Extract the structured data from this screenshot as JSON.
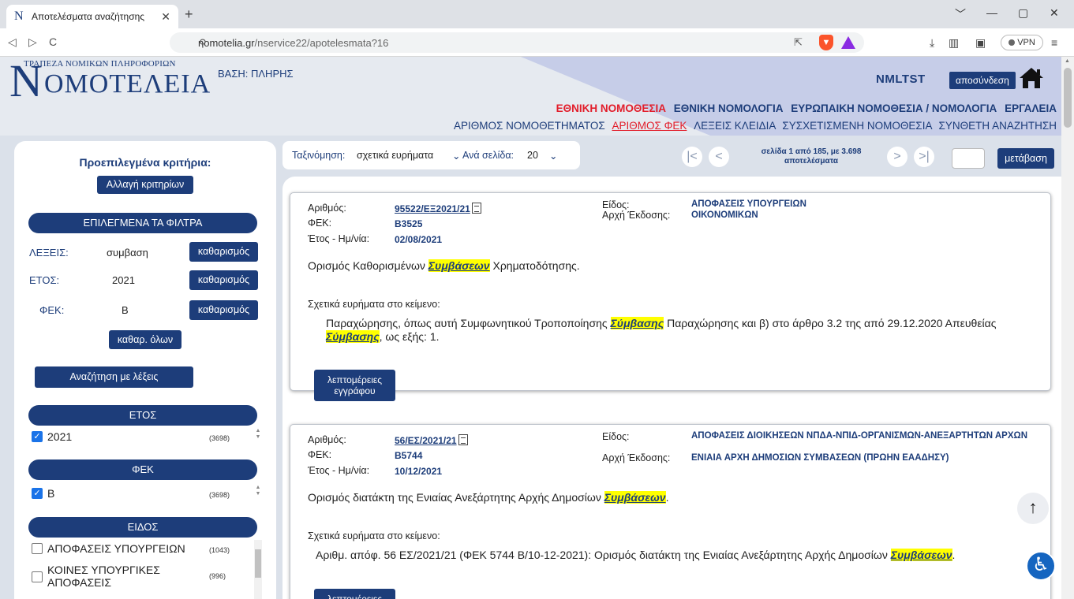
{
  "browser": {
    "tab_title": "Αποτελέσματα αναζήτησης",
    "tab_favicon": "N",
    "url_host": "nomotelia.gr",
    "url_path": "/nservice22/apotelesmata?16",
    "vpn_label": "VPN"
  },
  "header": {
    "logo_top": "ΤΡΑΠΕΖΑ ΝΟΜΙΚΩΝ ΠΛΗΡΟΦΟΡΙΩΝ",
    "logo_initial": "Ν",
    "logo_rest": "ΟΜΟΤΕΛΕΙΑ",
    "basis": "ΒΑΣΗ: ΠΛΗΡΗΣ",
    "username": "NMLTST",
    "logout_label": "αποσύνδεση",
    "nav_main": [
      "ΕΘΝΙΚΗ ΝΟΜΟΘΕΣΙΑ",
      "ΕΘΝΙΚΗ ΝΟΜΟΛΟΓΙΑ",
      "ΕΥΡΩΠΑΙΚΗ ΝΟΜΟΘΕΣΙΑ / ΝΟΜΟΛΟΓΙΑ",
      "ΕΡΓΑΛΕΙΑ"
    ],
    "nav_sub": [
      "ΑΡΙΘΜΟΣ ΝΟΜΟΘΕΤΗΜΑΤΟΣ",
      "ΑΡΙΘΜΟΣ ΦΕΚ",
      "ΛΕΞΕΙΣ ΚΛΕΙΔΙΑ",
      "ΣΥΣΧΕΤΙΣΜΕΝΗ ΝΟΜΟΘΕΣΙΑ",
      "ΣΥΝΘΕΤΗ ΑΝΑΖΗΤΗΣΗ"
    ],
    "active_color": "#e21d2a",
    "brand_color": "#1d3d7a"
  },
  "sidebar": {
    "title": "Προεπιλεγμένα κριτήρια:",
    "change_criteria": "Αλλαγή κριτηρίων",
    "selected_filters_header": "ΕΠΙΛΕΓΜΕΝΑ ΤΑ ΦΙΛΤΡΑ",
    "filters": [
      {
        "label": "ΛΕΞΕΙΣ:",
        "value": "συμβαση",
        "clear": "καθαρισμός"
      },
      {
        "label": "ΕΤΟΣ:",
        "value": "2021",
        "clear": "καθαρισμός"
      },
      {
        "label": "ΦΕΚ:",
        "value": "Β",
        "clear": "καθαρισμός"
      }
    ],
    "clear_all": "καθαρ. όλων",
    "search_words": "Αναζήτηση με λέξεις",
    "year_header": "ΕΤΟΣ",
    "year_items": [
      {
        "label": "2021",
        "count": "(3698)",
        "checked": true
      }
    ],
    "fek_header": "ΦΕΚ",
    "fek_items": [
      {
        "label": "Β",
        "count": "(3698)",
        "checked": true
      }
    ],
    "type_header": "ΕΙΔΟΣ",
    "type_items": [
      {
        "label": "ΑΠΟΦΑΣΕΙΣ ΥΠΟΥΡΓΕΙΩΝ",
        "count": "(1043)",
        "checked": false
      },
      {
        "label": "ΚΟΙΝΕΣ ΥΠΟΥΡΓΙΚΕΣ ΑΠΟΦΑΣΕΙΣ",
        "count": "(996)",
        "checked": false
      }
    ]
  },
  "toolbar": {
    "sort_label": "Ταξινόμηση:",
    "sort_value": "σχετικά ευρήματα",
    "per_page_label": "Ανά σελίδα:",
    "per_page_value": "20",
    "page_info_line1": "σελίδα 1 από 185, με 3.698",
    "page_info_line2": "αποτελέσματα",
    "goto_label": "μετάβαση",
    "page_input_value": ""
  },
  "results": [
    {
      "k_number": "Αριθμός:",
      "number": "95522/ΕΞ2021/21",
      "k_fek": "ΦΕΚ:",
      "fek": "Β3525",
      "k_date": "Έτος - Ημ/νία:",
      "date": "02/08/2021",
      "k_type": "Είδος:",
      "type": "ΑΠΟΦΑΣΕΙΣ ΥΠΟΥΡΓΕΙΩΝ",
      "k_issuer": "Αρχή Έκδοσης:",
      "issuer": "ΟΙΚΟΝΟΜΙΚΩΝ",
      "title_pre": "Ορισμός Καθορισμένων ",
      "title_hl": "Συμβάσεων",
      "title_post": " Χρηματοδότησης.",
      "related_label": "Σχετικά ευρήματα στο κείμενο:",
      "snip_a": "Παραχώρησης, όπως αυτή Συμφωνητικού Τροποποίησης ",
      "snip_hl1": "Σύμβασης",
      "snip_b": " Παραχώρησης και β) στο άρθρο 3.2 της από 29.12.2020 Απευθείας ",
      "snip_hl2": "Σύμβασης",
      "snip_c": ", ως εξής: 1.",
      "details_label": "λεπτομέρειες εγγράφου"
    },
    {
      "k_number": "Αριθμός:",
      "number": "56/ΕΣ/2021/21",
      "k_fek": "ΦΕΚ:",
      "fek": "Β5744",
      "k_date": "Έτος - Ημ/νία:",
      "date": "10/12/2021",
      "k_type": "Είδος:",
      "type": "ΑΠΟΦΑΣΕΙΣ ΔΙΟΙΚΗΣΕΩΝ ΝΠΔΑ-ΝΠΙΔ-ΟΡΓΑΝΙΣΜΩΝ-ΑΝΕΞΑΡΤΗΤΩΝ ΑΡΧΩΝ",
      "k_issuer": "Αρχή Έκδοσης:",
      "issuer": "ΕΝΙΑΙΑ ΑΡΧΗ ΔΗΜΟΣΙΩΝ ΣΥΜΒΑΣΕΩΝ (ΠΡΩΗΝ ΕΑΑΔΗΣΥ)",
      "title_pre": "Ορισμός διατάκτη της Ενιαίας Ανεξάρτητης Αρχής Δημοσίων ",
      "title_hl": "Συμβάσεων",
      "title_post": ".",
      "related_label": "Σχετικά ευρήματα στο κείμενο:",
      "snip_a": "Αριθμ. απόφ. 56 ΕΣ/2021/21 (ΦΕΚ 5744 Β/10-12-2021): Ορισμός διατάκτη της Ενιαίας Ανεξάρτητης Αρχής Δημοσίων ",
      "snip_hl1": "Συμβάσεων",
      "snip_b": ".",
      "details_label": "λεπτομέρειες"
    }
  ]
}
